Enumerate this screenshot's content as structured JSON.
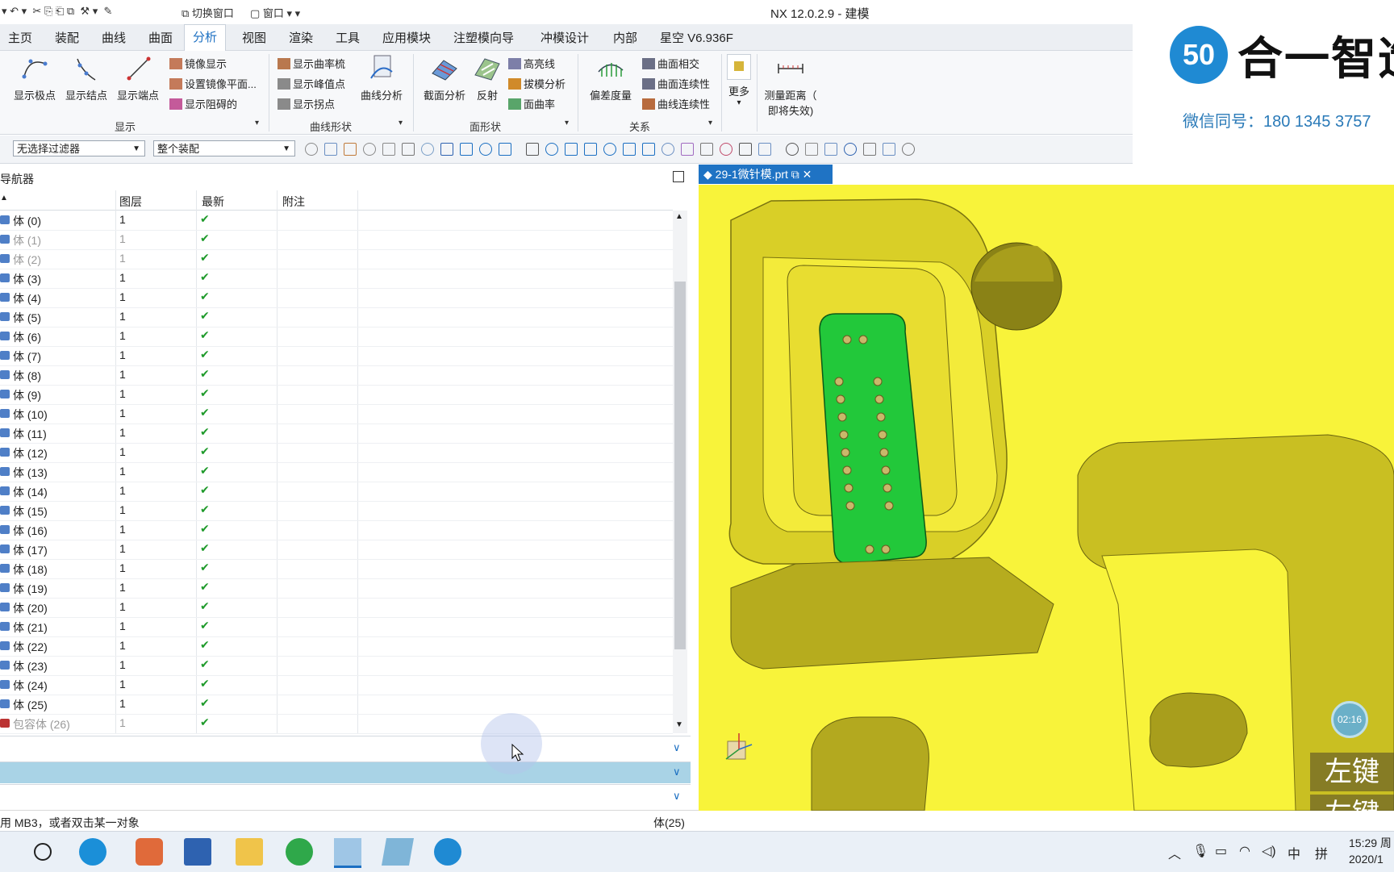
{
  "app": {
    "title": "NX 12.0.2.9 - 建模"
  },
  "quick_access": {
    "switch_window": "切换窗口",
    "window": "窗口"
  },
  "menu_tabs": [
    "主页",
    "装配",
    "曲线",
    "曲面",
    "分析",
    "视图",
    "渲染",
    "工具",
    "应用模块",
    "注塑模向导",
    "冲模设计",
    "内部",
    "星空 V6.936F"
  ],
  "active_tab": "分析",
  "ribbon": {
    "display": {
      "label": "显示",
      "big": [
        "显示极点",
        "显示结点",
        "显示端点"
      ],
      "small": [
        "镜像显示",
        "设置镜像平面...",
        "显示阻碍的"
      ]
    },
    "curve_shape": {
      "label": "曲线形状",
      "small": [
        "显示曲率梳",
        "显示峰值点",
        "显示拐点"
      ],
      "big": "曲线分析"
    },
    "face_shape": {
      "label": "面形状",
      "big": [
        "截面分析",
        "反射"
      ],
      "small": [
        "高亮线",
        "拔模分析",
        "面曲率"
      ]
    },
    "relation": {
      "label": "关系",
      "big": "偏差度量",
      "small": [
        "曲面相交",
        "曲面连续性",
        "曲线连续性"
      ]
    },
    "more": "更多",
    "measure": {
      "line1": "测量距离（",
      "line2": "即将失效)"
    }
  },
  "filter_bar": {
    "selection_filter": "无选择过滤器",
    "scope": "整个装配"
  },
  "brand": {
    "logo_text": "合一智造",
    "wechat": "微信同号：180 1345 3757"
  },
  "navigator": {
    "title": "导航器",
    "columns": [
      "",
      "图层",
      "最新",
      "附注"
    ],
    "rows": [
      {
        "name": "体 (0)",
        "layer": "1",
        "dim": false
      },
      {
        "name": "体 (1)",
        "layer": "1",
        "dim": true
      },
      {
        "name": "体 (2)",
        "layer": "1",
        "dim": true
      },
      {
        "name": "体 (3)",
        "layer": "1",
        "dim": false
      },
      {
        "name": "体 (4)",
        "layer": "1",
        "dim": false
      },
      {
        "name": "体 (5)",
        "layer": "1",
        "dim": false
      },
      {
        "name": "体 (6)",
        "layer": "1",
        "dim": false
      },
      {
        "name": "体 (7)",
        "layer": "1",
        "dim": false
      },
      {
        "name": "体 (8)",
        "layer": "1",
        "dim": false
      },
      {
        "name": "体 (9)",
        "layer": "1",
        "dim": false
      },
      {
        "name": "体 (10)",
        "layer": "1",
        "dim": false
      },
      {
        "name": "体 (11)",
        "layer": "1",
        "dim": false
      },
      {
        "name": "体 (12)",
        "layer": "1",
        "dim": false
      },
      {
        "name": "体 (13)",
        "layer": "1",
        "dim": false
      },
      {
        "name": "体 (14)",
        "layer": "1",
        "dim": false
      },
      {
        "name": "体 (15)",
        "layer": "1",
        "dim": false
      },
      {
        "name": "体 (16)",
        "layer": "1",
        "dim": false
      },
      {
        "name": "体 (17)",
        "layer": "1",
        "dim": false
      },
      {
        "name": "体 (18)",
        "layer": "1",
        "dim": false
      },
      {
        "name": "体 (19)",
        "layer": "1",
        "dim": false
      },
      {
        "name": "体 (20)",
        "layer": "1",
        "dim": false
      },
      {
        "name": "体 (21)",
        "layer": "1",
        "dim": false
      },
      {
        "name": "体 (22)",
        "layer": "1",
        "dim": false
      },
      {
        "name": "体 (23)",
        "layer": "1",
        "dim": false
      },
      {
        "name": "体 (24)",
        "layer": "1",
        "dim": false
      },
      {
        "name": "体 (25)",
        "layer": "1",
        "dim": false
      },
      {
        "name": "包容体 (26)",
        "layer": "1",
        "dim": true
      }
    ],
    "check": "✔"
  },
  "status": {
    "left": "用 MB3，或者双击某一对象",
    "right": "体(25)"
  },
  "viewport": {
    "tab_label": "29-1微针模.prt",
    "timer": "02:16",
    "key_hint_1": "左键",
    "key_hint_2": "左键"
  },
  "taskbar": {
    "time": "15:29 周",
    "date": "2020/1",
    "ime": "中",
    "ime2": "拼"
  },
  "colors": {
    "model_yellow": "#f8f33a",
    "insert_green": "#22c83a",
    "accent": "#1b6fc2",
    "check_green": "#1e9a2a"
  }
}
